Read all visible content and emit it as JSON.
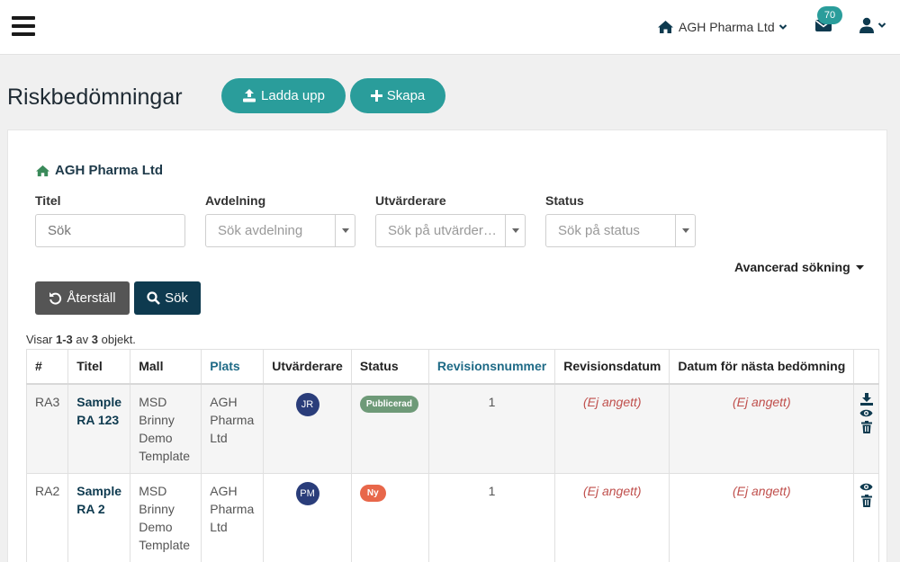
{
  "header": {
    "company": "AGH Pharma Ltd",
    "mail_count": "70",
    "icons": {
      "menu": "hamburger-icon",
      "home": "home-icon",
      "chevron": "chevron-down-icon",
      "mail": "envelope-icon",
      "user": "user-icon"
    }
  },
  "page": {
    "title": "Riskbedömningar",
    "upload_label": "Ladda upp",
    "create_label": "Skapa"
  },
  "filters": {
    "org_name": "AGH Pharma Ltd",
    "title_label": "Titel",
    "title_placeholder": "Sök",
    "department_label": "Avdelning",
    "department_placeholder": "Sök avdelning",
    "evaluator_label": "Utvärderare",
    "evaluator_placeholder": "Sök på utvärderare",
    "status_label": "Status",
    "status_placeholder": "Sök på status",
    "advanced_label": "Avancerad sökning",
    "reset_label": "Återställ",
    "search_label": "Sök"
  },
  "results": {
    "prefix": "Visar ",
    "range": "1-3",
    "middle": " av ",
    "total": "3",
    "suffix": " objekt."
  },
  "table": {
    "headers": [
      "#",
      "Titel",
      "Mall",
      "Plats",
      "Utvärderare",
      "Status",
      "Revisionsnummer",
      "Revisionsdatum",
      "Datum för nästa bedömning"
    ],
    "rows": [
      {
        "id": "RA3",
        "title": "Sample RA 123",
        "template": "MSD Brinny Demo Template",
        "location": "AGH Pharma Ltd",
        "evaluator": "JR",
        "status": "Publicerad",
        "revision": "1",
        "revision_date": "(Ej angett)",
        "next_date": "(Ej angett)"
      },
      {
        "id": "RA2",
        "title": "Sample RA 2",
        "template": "MSD Brinny Demo Template",
        "location": "AGH Pharma Ltd",
        "evaluator": "PM",
        "status": "Ny",
        "revision": "1",
        "revision_date": "(Ej angett)",
        "next_date": "(Ej angett)"
      }
    ]
  },
  "colors": {
    "teal": "#2a9d9b",
    "navy": "#0e3a4f",
    "published": "#6e9a78",
    "new": "#e8674a",
    "empty": "#c0504d"
  }
}
